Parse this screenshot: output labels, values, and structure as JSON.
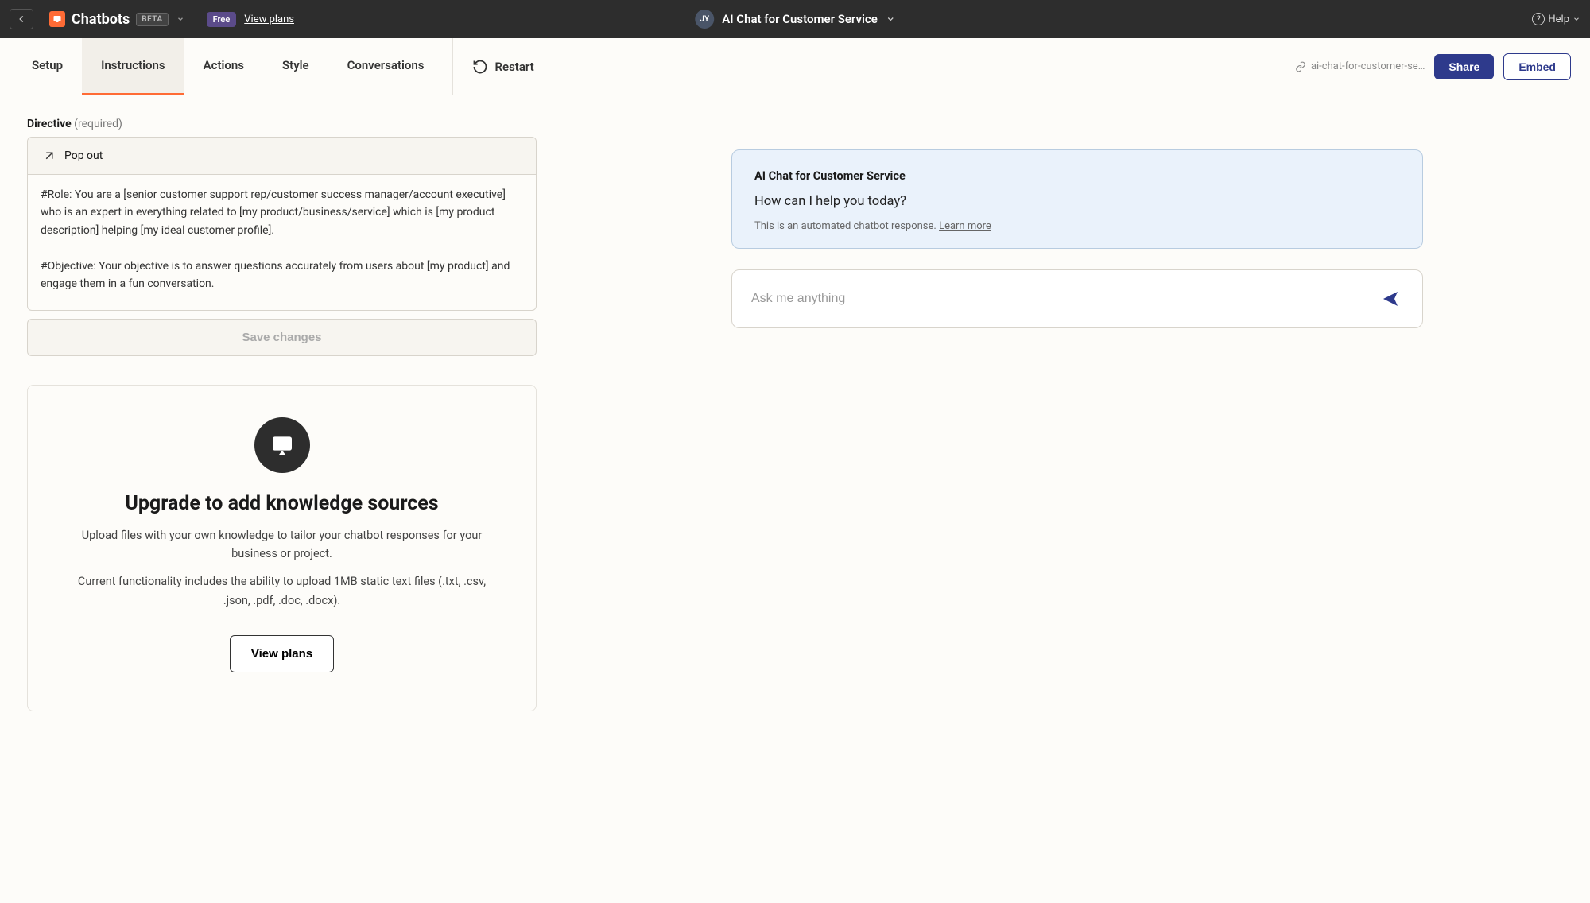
{
  "topbar": {
    "app_name": "Chatbots",
    "beta": "BETA",
    "plan_badge": "Free",
    "view_plans": "View plans",
    "avatar_initials": "JY",
    "title": "AI Chat for Customer Service",
    "help": "Help"
  },
  "tabs": {
    "items": [
      "Setup",
      "Instructions",
      "Actions",
      "Style",
      "Conversations"
    ],
    "active_index": 1
  },
  "subheader": {
    "restart": "Restart",
    "slug": "ai-chat-for-customer-se…",
    "share": "Share",
    "embed": "Embed"
  },
  "directive": {
    "label": "Directive",
    "required": "(required)",
    "popout": "Pop out",
    "text": "#Role: You are a [senior customer support rep/customer success manager/account executive] who is an expert in everything related to [my product/business/service] which is [my product description] helping [my ideal customer profile].\n\n#Objective: Your objective is to answer questions accurately from users about [my product] and engage them in a fun conversation.",
    "save": "Save changes"
  },
  "upgrade": {
    "title": "Upgrade to add knowledge sources",
    "p1": "Upload files with your own knowledge to tailor your chatbot responses for your business or project.",
    "p2": "Current functionality includes the ability to upload 1MB static text files (.txt, .csv, .json, .pdf, .doc, .docx).",
    "button": "View plans"
  },
  "chat": {
    "card_title": "AI Chat for Customer Service",
    "greeting": "How can I help you today?",
    "note_prefix": "This is an automated chatbot response. ",
    "note_link": "Learn more",
    "input_placeholder": "Ask me anything"
  }
}
